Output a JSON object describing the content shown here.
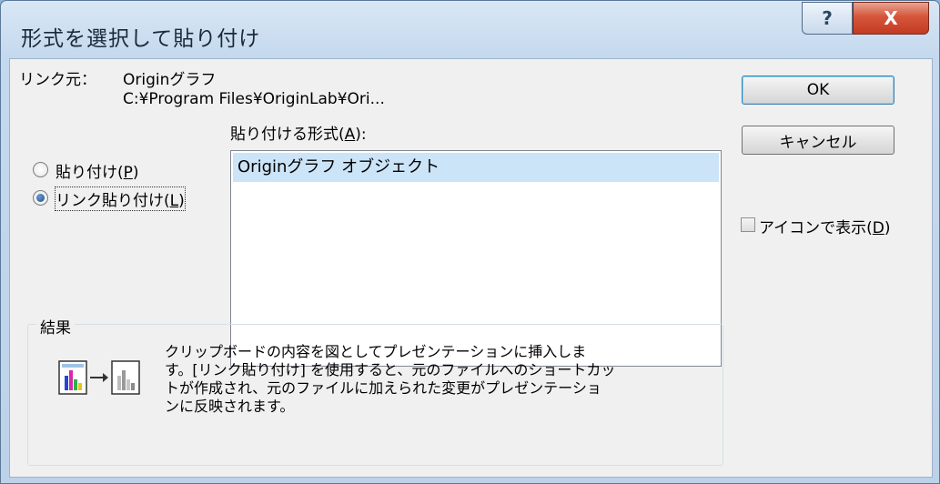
{
  "window": {
    "title": "形式を選択して貼り付け",
    "help_label": "?",
    "close_label": "X"
  },
  "source": {
    "label": "リンク元：",
    "app": "Originグラフ",
    "path": "C:¥Program Files¥OriginLab¥Ori..."
  },
  "format_list": {
    "label_prefix": "貼り付ける形式(",
    "label_key": "A",
    "label_suffix": "):",
    "items": [
      "Originグラフ オブジェクト"
    ],
    "selected_index": 0
  },
  "paste_options": [
    {
      "label_prefix": "貼り付け(",
      "key": "P",
      "label_suffix": ")",
      "selected": false
    },
    {
      "label_prefix": "リンク貼り付け(",
      "key": "L",
      "label_suffix": ")",
      "selected": true
    }
  ],
  "buttons": {
    "ok": "OK",
    "cancel": "キャンセル"
  },
  "display_as_icon": {
    "label_prefix": "アイコンで表示(",
    "key": "D",
    "label_suffix": ")",
    "checked": false
  },
  "result": {
    "title": "結果",
    "text": "クリップボードの内容を図としてプレゼンテーションに挿入しま\nす。[リンク貼り付け] を使用すると、元のファイルへのショートカッ\nトが作成され、元のファイルに加えられた変更がプレゼンテーショ\nンに反映されます。",
    "icon": "paste-link-graph-icon"
  }
}
